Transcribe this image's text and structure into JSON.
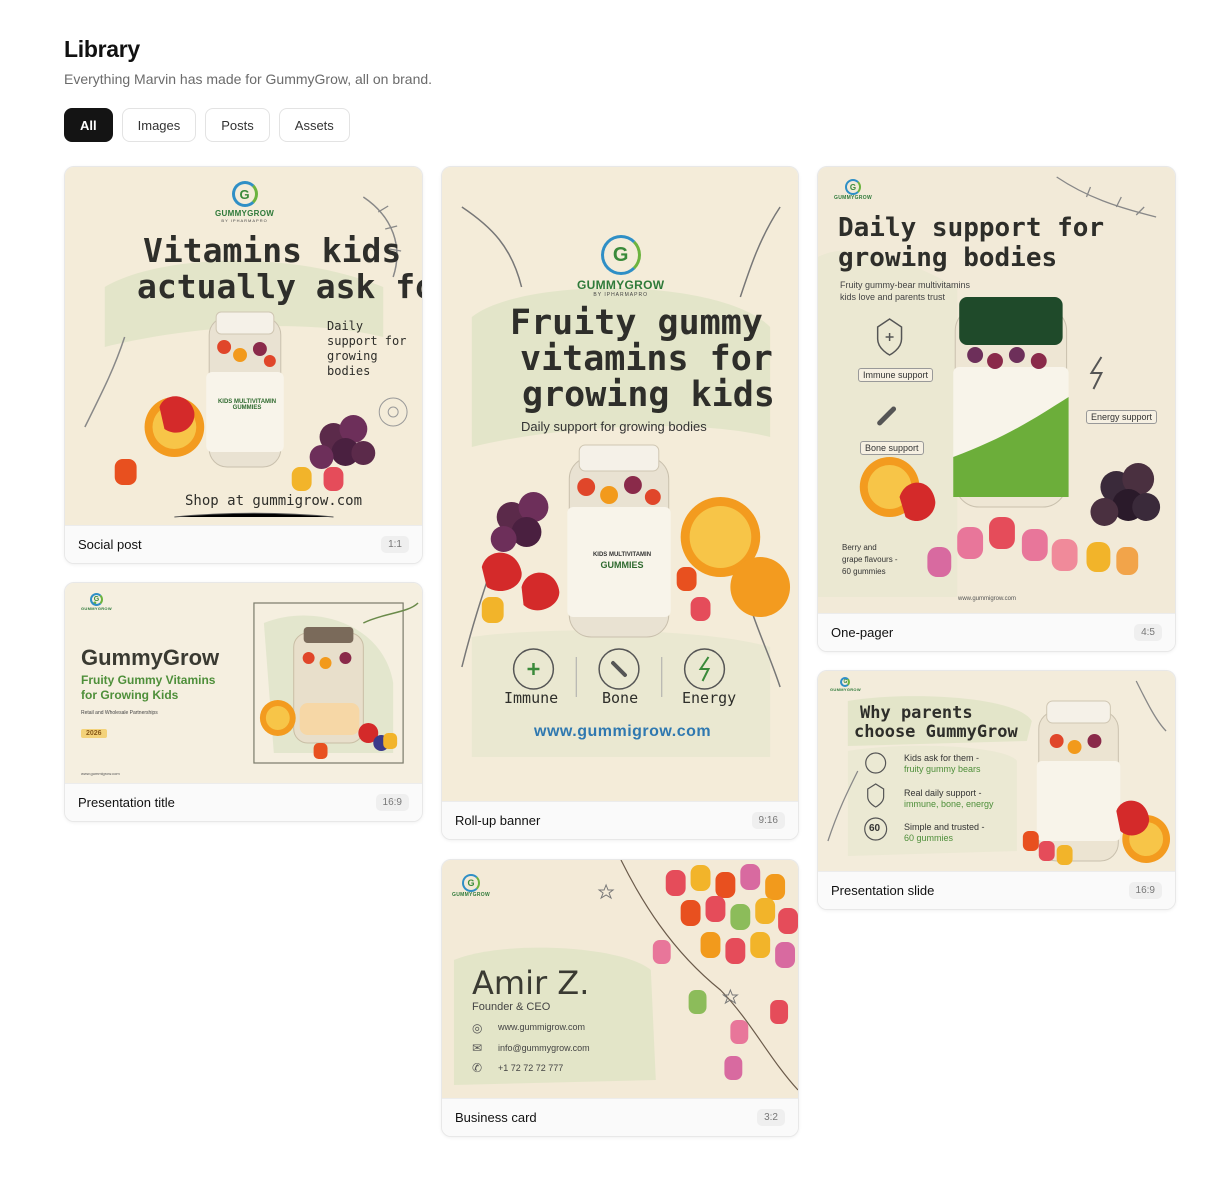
{
  "header": {
    "title": "Library",
    "subtitle": "Everything Marvin has made for GummyGrow, all on brand."
  },
  "filters": [
    {
      "label": "All",
      "active": true
    },
    {
      "label": "Images",
      "active": false
    },
    {
      "label": "Posts",
      "active": false
    },
    {
      "label": "Assets",
      "active": false
    }
  ],
  "brand": {
    "name": "GUMMYGROW",
    "sub": "BY IPHARMAPRO",
    "accent": "#2f8fc6",
    "green": "#6cb33f"
  },
  "cards": {
    "social_post": {
      "label": "Social post",
      "ratio": "1:1",
      "headline_1": "Vitamins kids",
      "headline_2": "actually ask for",
      "side_note": "Daily support for growing bodies",
      "cta": "Shop at gummigrow.com",
      "jar_text": "KIDS MULTIVITAMIN GUMMIES"
    },
    "presentation_title": {
      "label": "Presentation title",
      "ratio": "16:9",
      "title": "GummyGrow",
      "subtitle_1": "Fruity Gummy Vitamins",
      "subtitle_2": "for Growing Kids",
      "tagline": "Retail and Wholesale Partnerships",
      "year": "2026",
      "url": "www.gummigrow.com"
    },
    "rollup_banner": {
      "label": "Roll-up banner",
      "ratio": "9:16",
      "headline_1": "Fruity gummy",
      "headline_2": "vitamins for",
      "headline_3": "growing kids",
      "sub": "Daily support for growing bodies",
      "jar_text_1": "KIDS MULTIVITAMIN",
      "jar_text_2": "GUMMIES",
      "benefits": [
        "Immune",
        "Bone",
        "Energy"
      ],
      "url": "www.gummigrow.com"
    },
    "business_card": {
      "label": "Business card",
      "ratio": "3:2",
      "name": "Amir Z.",
      "role": "Founder & CEO",
      "web": "www.gummigrow.com",
      "email": "info@gummygrow.com",
      "phone": "+1 72 72 72 777"
    },
    "one_pager": {
      "label": "One-pager",
      "ratio": "4:5",
      "headline_1": "Daily support for",
      "headline_2": "growing bodies",
      "sub_1": "Fruity gummy-bear multivitamins",
      "sub_2": "kids love and parents trust",
      "tags": [
        "Immune support",
        "Bone support",
        "Energy support"
      ],
      "flavour_1": "Berry and",
      "flavour_2": "grape flavours -",
      "flavour_3": "60 gummies",
      "url": "www.gummigrow.com"
    },
    "presentation_slide": {
      "label": "Presentation slide",
      "ratio": "16:9",
      "title_1": "Why parents",
      "title_2": "choose GummyGrow",
      "points": [
        {
          "a": "Kids ask for them -",
          "b": "fruity gummy bears"
        },
        {
          "a": "Real daily support -",
          "b": "immune, bone, energy"
        },
        {
          "a": "Simple and trusted -",
          "b": "60 gummies"
        }
      ],
      "badge": "60"
    }
  }
}
